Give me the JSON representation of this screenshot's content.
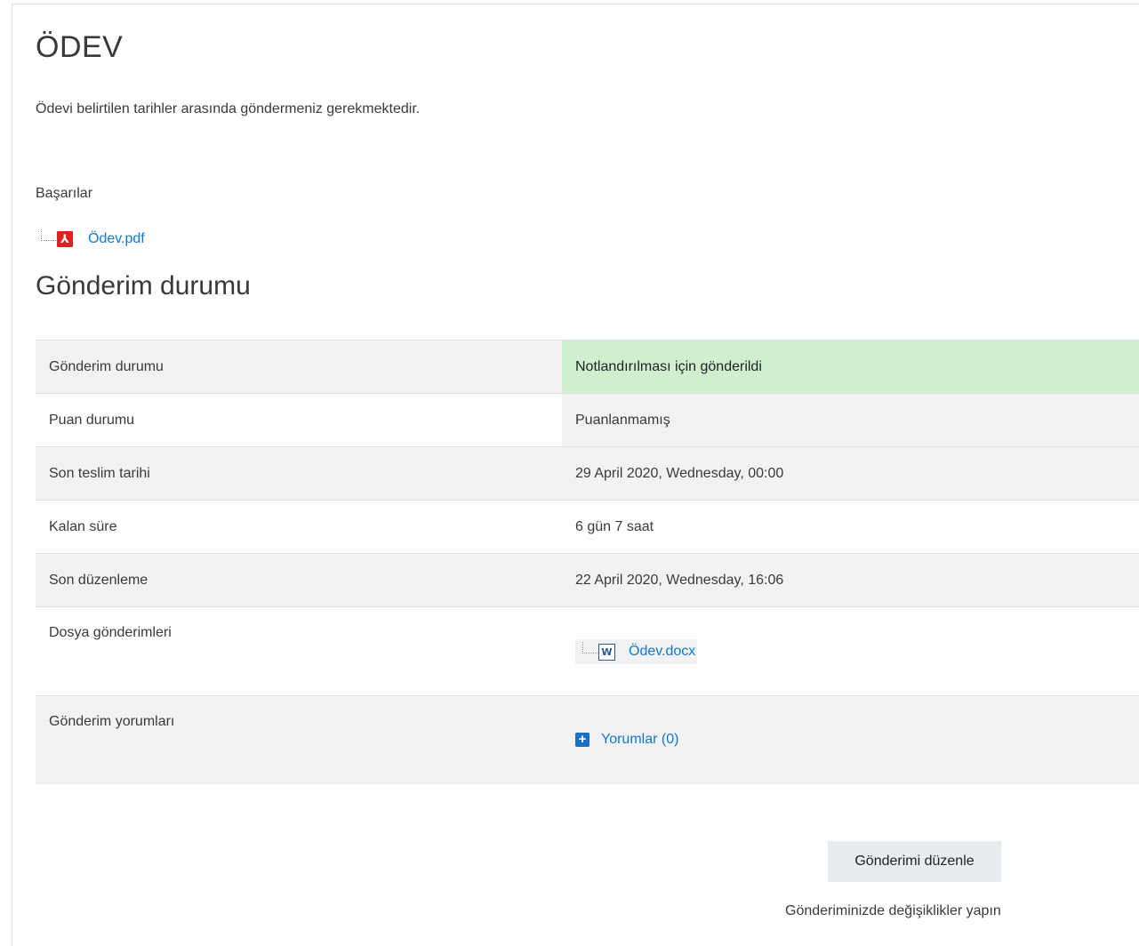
{
  "page": {
    "title": "ÖDEV",
    "intro": "Ödevi belirtilen tarihler arasında göndermeniz gerekmektedir.",
    "note": "Başarılar",
    "attachment": {
      "name": "Ödev.pdf",
      "icon": "pdf-file-icon"
    }
  },
  "submission": {
    "section_title": "Gönderim durumu",
    "rows": [
      {
        "label": "Gönderim durumu",
        "value": "Notlandırılması için gönderildi"
      },
      {
        "label": "Puan durumu",
        "value": "Puanlanmamış"
      },
      {
        "label": "Son teslim tarihi",
        "value": "29 April 2020, Wednesday, 00:00"
      },
      {
        "label": "Kalan süre",
        "value": "6 gün 7 saat"
      },
      {
        "label": "Son düzenleme",
        "value": "22 April 2020, Wednesday, 16:06"
      },
      {
        "label": "Dosya gönderimleri",
        "file": "Ödev.docx",
        "icon": "word-file-icon"
      },
      {
        "label": "Gönderim yorumları",
        "link": "Yorumlar (0)",
        "icon": "plus-square-icon"
      }
    ]
  },
  "actions": {
    "edit_button": "Gönderimi düzenle",
    "edit_hint": "Gönderiminizde değişiklikler yapın"
  },
  "colors": {
    "link": "#1177d1",
    "submitted_bg": "#cfefcf",
    "stripe_bg": "#f2f2f2",
    "pdf_red": "#e02121"
  }
}
